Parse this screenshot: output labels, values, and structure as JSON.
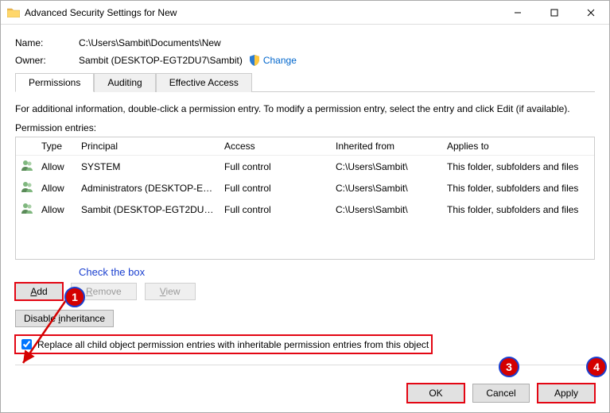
{
  "window": {
    "title": "Advanced Security Settings for New"
  },
  "fields": {
    "name_label": "Name:",
    "name_value": "C:\\Users\\Sambit\\Documents\\New",
    "owner_label": "Owner:",
    "owner_value": "Sambit (DESKTOP-EGT2DU7\\Sambit)",
    "change_link": "Change"
  },
  "tabs": {
    "permissions": "Permissions",
    "auditing": "Auditing",
    "effective": "Effective Access"
  },
  "info_text": "For additional information, double-click a permission entry. To modify a permission entry, select the entry and click Edit (if available).",
  "entries_label": "Permission entries:",
  "columns": {
    "type": "Type",
    "principal": "Principal",
    "access": "Access",
    "inherited": "Inherited from",
    "applies": "Applies to"
  },
  "entries": [
    {
      "type": "Allow",
      "principal": "SYSTEM",
      "access": "Full control",
      "inherited": "C:\\Users\\Sambit\\",
      "applies": "This folder, subfolders and files"
    },
    {
      "type": "Allow",
      "principal": "Administrators (DESKTOP-EG...",
      "access": "Full control",
      "inherited": "C:\\Users\\Sambit\\",
      "applies": "This folder, subfolders and files"
    },
    {
      "type": "Allow",
      "principal": "Sambit (DESKTOP-EGT2DU7\\S...",
      "access": "Full control",
      "inherited": "C:\\Users\\Sambit\\",
      "applies": "This folder, subfolders and files"
    }
  ],
  "annotation": "Check the box",
  "buttons": {
    "add": "Add",
    "remove": "Remove",
    "view": "View",
    "disable_inh": "Disable inheritance",
    "ok": "OK",
    "cancel": "Cancel",
    "apply": "Apply"
  },
  "checkbox_label": "Replace all child object permission entries with inheritable permission entries from this object",
  "badges": {
    "b1": "1",
    "b3": "3",
    "b4": "4"
  }
}
